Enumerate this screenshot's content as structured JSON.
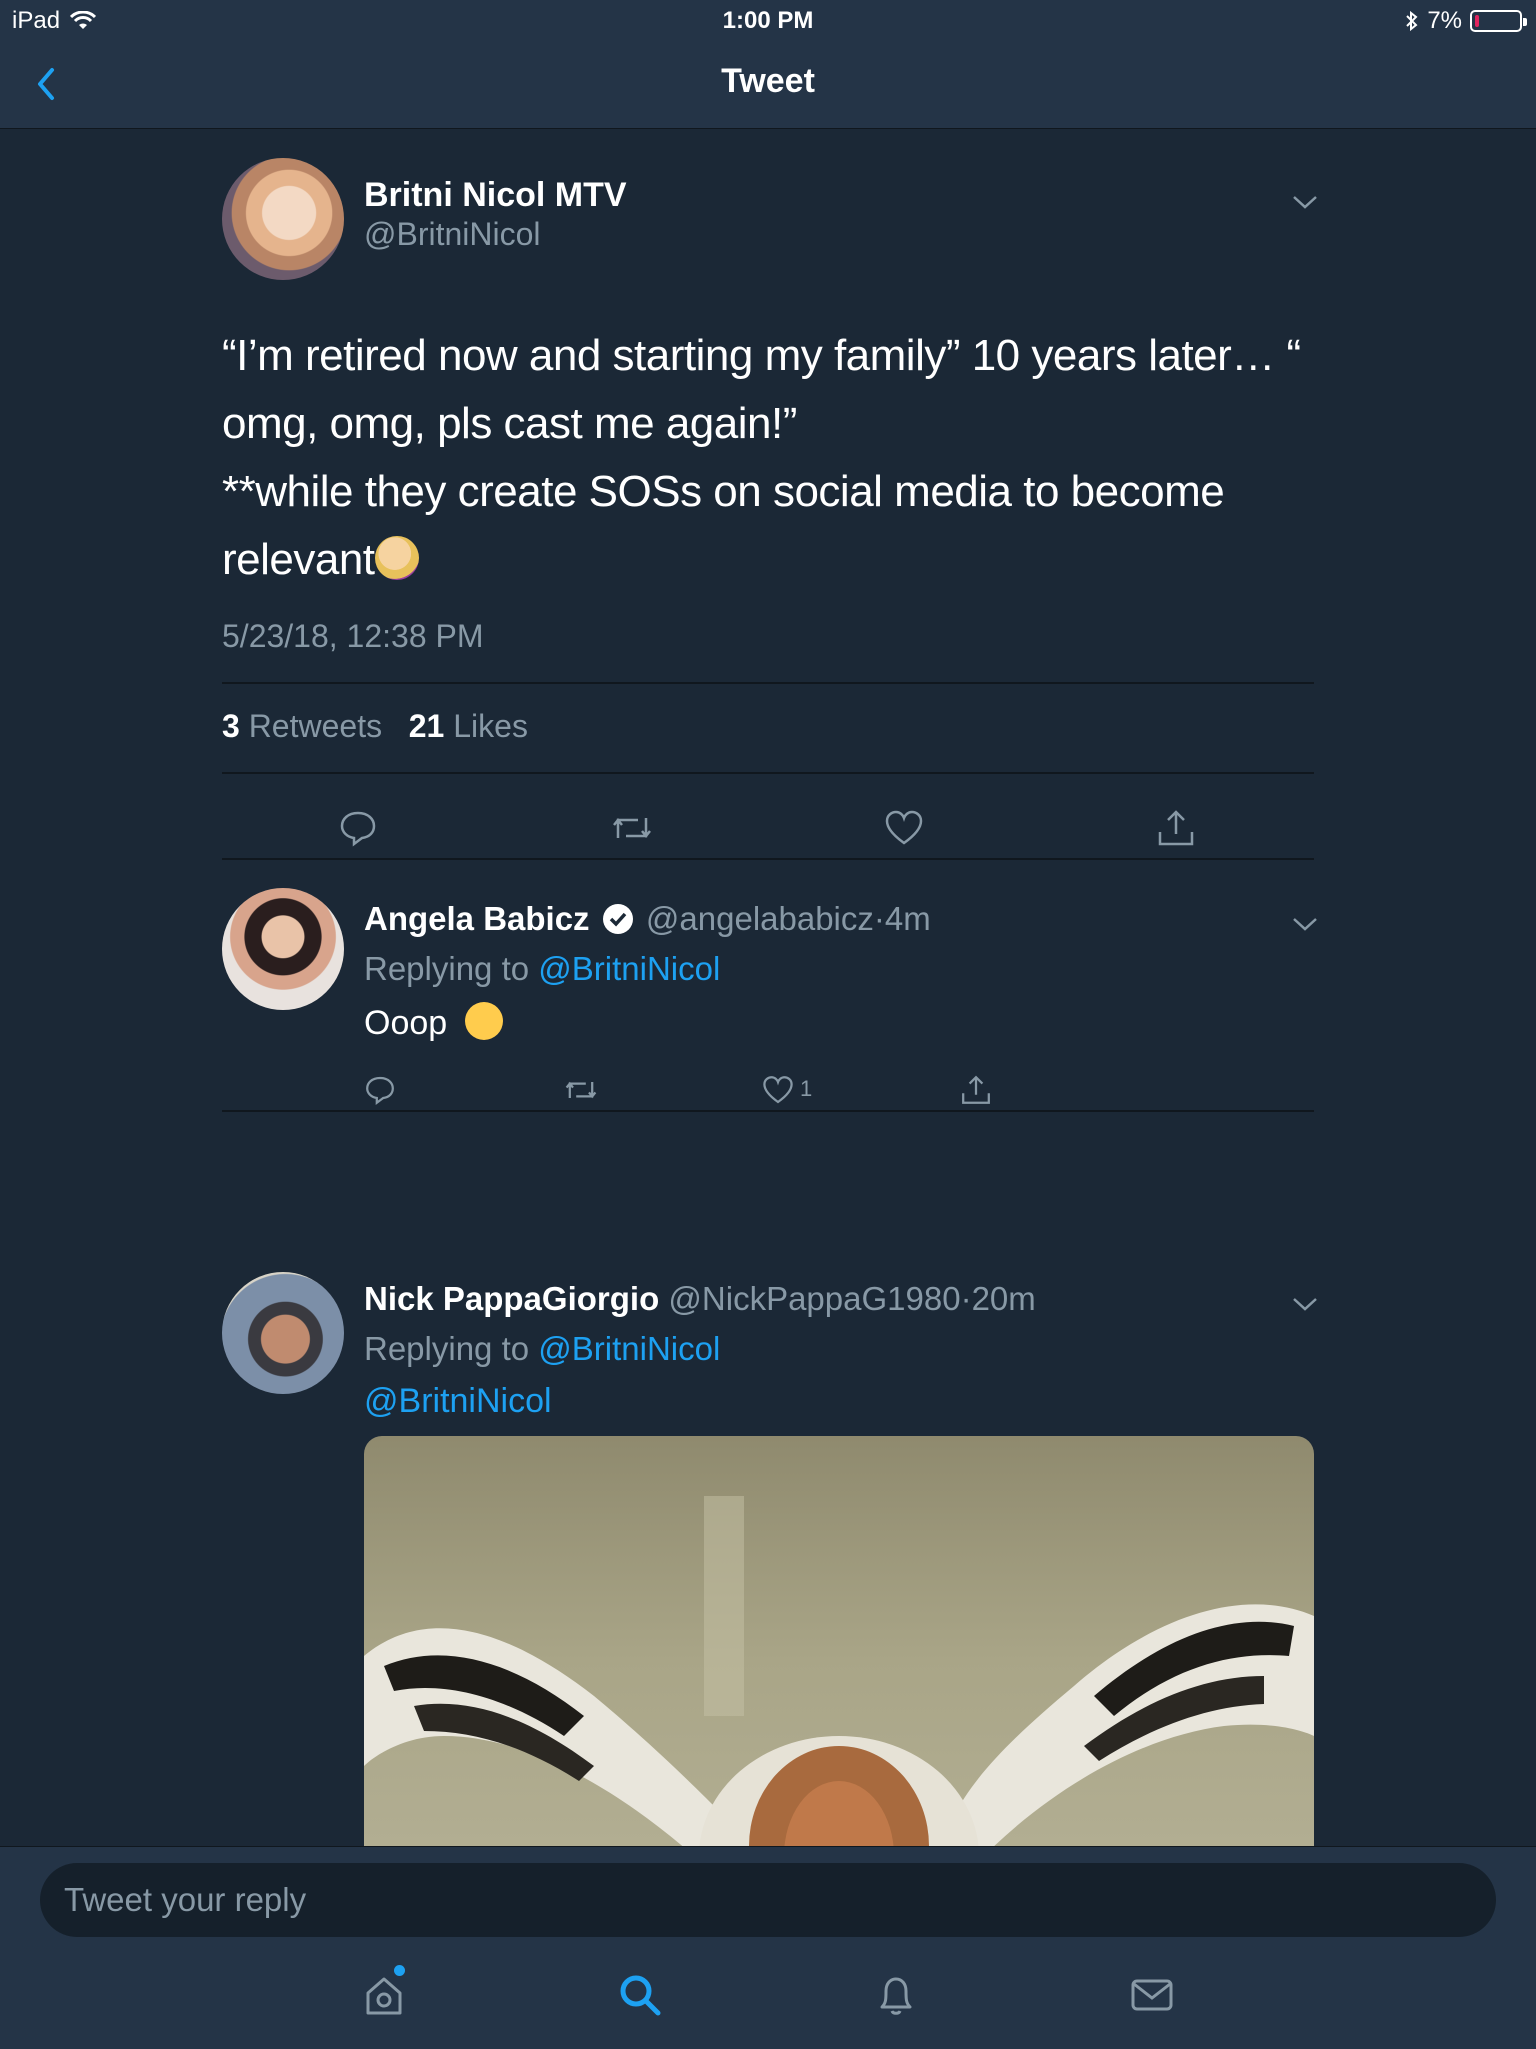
{
  "status_bar": {
    "device": "iPad",
    "time": "1:00 PM",
    "battery": "7%",
    "battery_level": 0.07
  },
  "nav": {
    "title": "Tweet"
  },
  "main_tweet": {
    "name": "Britni Nicol MTV",
    "handle": "@BritniNicol",
    "text": "“I’m retired now and starting my family” 10 years later… “\nomg, omg, pls cast me again!”\n**while they create SOSs on social media to become\nrelevant",
    "emoji": "woman-facepalming-emoji",
    "timestamp": "5/23/18, 12:38 PM",
    "retweet_count": "3",
    "retweet_label": "Retweets",
    "like_count": "21",
    "like_label": "Likes"
  },
  "replies": [
    {
      "name": "Angela Babicz",
      "verified": true,
      "handle": "@angelababicz",
      "separator": "·",
      "time": "4m",
      "replying_prefix": "Replying to",
      "replying_to": "@BritniNicol",
      "text": "Ooop",
      "emoji": "upside-down-face-emoji",
      "like_count": "1"
    },
    {
      "name": "Nick PappaGiorgio",
      "handle": "@NickPappaG1980",
      "separator": "·",
      "time": "20m",
      "replying_prefix": "Replying to",
      "replying_to": "@BritniNicol",
      "text": "@BritniNicol"
    }
  ],
  "composer": {
    "placeholder": "Tweet your reply"
  },
  "tab_bar": [
    "home-icon",
    "search-icon",
    "notifications-icon",
    "messages-icon"
  ],
  "colors": {
    "background": "#1b2836",
    "bar": "#243447",
    "accent": "#1da1f2",
    "secondary_text": "#8899a6"
  }
}
